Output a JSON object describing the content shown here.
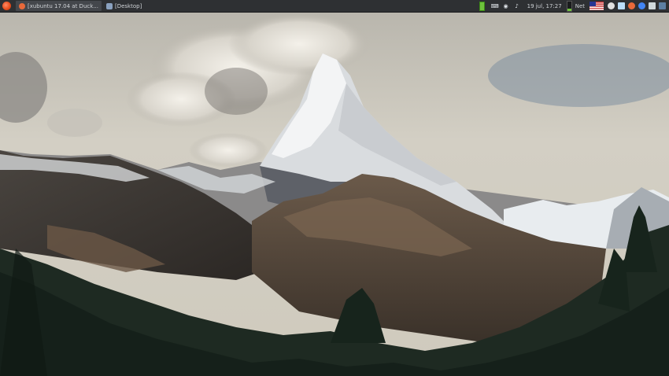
{
  "panel": {
    "tasks": [
      {
        "label": "[xubuntu 17.04 at Duck...",
        "icon": "firefox-icon",
        "active": true
      },
      {
        "label": "[Desktop]",
        "icon": "desktop-icon",
        "active": false
      }
    ],
    "tray": {
      "clock": "19 jul, 17:27",
      "network_label": "Net",
      "icons": [
        "battery-icon",
        "keyboard-icon",
        "wifi-icon",
        "volume-icon",
        "cpu-graph-icon",
        "flag-us-icon",
        "settings-icon",
        "mail-icon",
        "firefox-icon",
        "chrome-icon",
        "user-icon",
        "display-icon"
      ]
    }
  },
  "colors": {
    "panel_bg": "#2e3033",
    "panel_text": "#cfd2d6",
    "sky": "#c9c4b8",
    "snow": "#eef0f2",
    "forest": "#1e2a22"
  }
}
